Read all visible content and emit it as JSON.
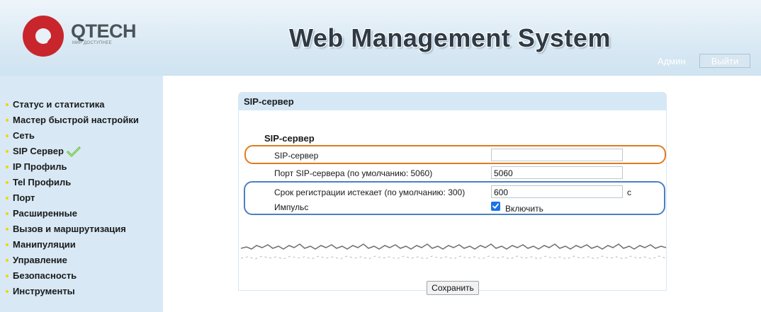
{
  "header": {
    "brand": "QTECH",
    "tagline": "МИР ДОСТУПНЕЕ",
    "title": "Web Management System",
    "user_label": "Админ",
    "logout_label": "Выйти"
  },
  "sidebar": {
    "items": [
      {
        "label": "Статус и статистика"
      },
      {
        "label": "Мастер быстрой настройки"
      },
      {
        "label": "Сеть"
      },
      {
        "label": "SIP Сервер",
        "icon": "check-icon"
      },
      {
        "label": "IP Профиль"
      },
      {
        "label": "Tel Профиль"
      },
      {
        "label": "Порт"
      },
      {
        "label": "Расширенные"
      },
      {
        "label": "Вызов и маршрутизация"
      },
      {
        "label": "Манипуляции"
      },
      {
        "label": "Управление"
      },
      {
        "label": "Безопасность"
      },
      {
        "label": "Инструменты"
      }
    ]
  },
  "panel": {
    "title": "SIP-сервер",
    "section_title": "SIP-сервер",
    "fields": {
      "sip_server": {
        "label": "SIP-сервер",
        "value": ""
      },
      "sip_port": {
        "label": "Порт SIP-сервера (по умолчанию: 5060)",
        "value": "5060"
      },
      "reg_expire": {
        "label": "Срок регистрации истекает (по умолчанию: 300)",
        "value": "600",
        "unit": "с"
      },
      "pulse": {
        "label": "Импульс",
        "checkbox_label": "Включить",
        "checked": true
      }
    },
    "save_label": "Сохранить"
  },
  "colors": {
    "header_bg": "#d9e9f4",
    "sidebar_bg": "#d8e9f5",
    "brand_red": "#c8262c",
    "bullet_yellow": "#f3d500",
    "highlight_orange": "#e07b1f",
    "highlight_blue": "#4c7fc4",
    "checkbox_blue": "#1a73e8"
  }
}
